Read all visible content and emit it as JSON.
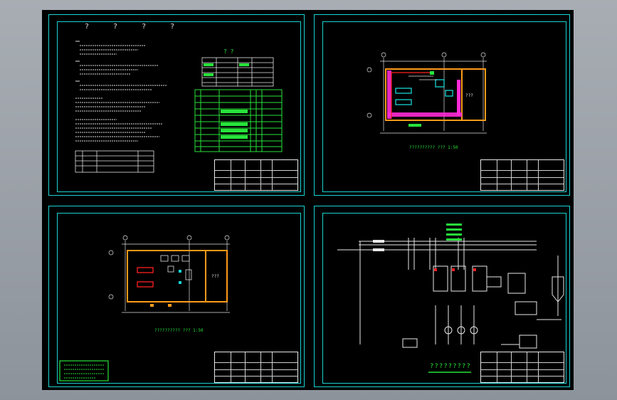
{
  "sheet1": {
    "title_marks": "? ? ? ?",
    "table_header_marks": "?   ?"
  },
  "sheet2": {
    "plan_caption": "??????????  ??? 1:50",
    "room_label": "???"
  },
  "sheet3": {
    "plan_caption": "??????????  ??? 1:50",
    "room_label": "???"
  },
  "sheet4": {
    "diagram_title": "?????????"
  },
  "colors": {
    "frame": "#19d3d3",
    "canvas": "#000000",
    "green": "#27e33a",
    "magenta": "#ff2bd6",
    "orange": "#ff9a1a",
    "red": "#ff2020"
  }
}
